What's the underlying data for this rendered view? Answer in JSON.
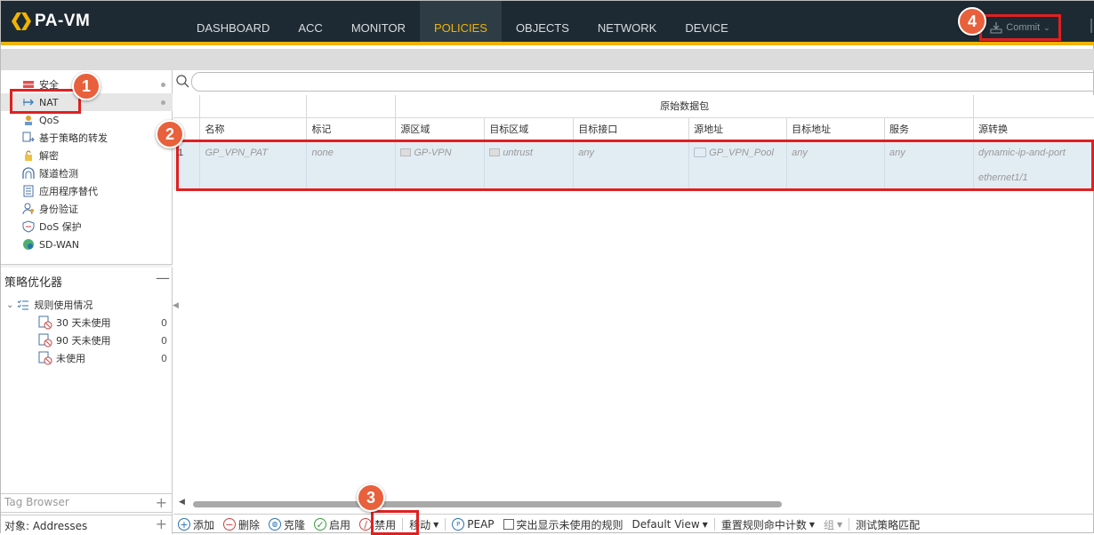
{
  "app": {
    "logo": "PA-VM"
  },
  "nav": {
    "tabs": [
      "DASHBOARD",
      "ACC",
      "MONITOR",
      "POLICIES",
      "OBJECTS",
      "NETWORK",
      "DEVICE"
    ],
    "active": "POLICIES"
  },
  "commit": {
    "label": "Commit"
  },
  "policy_nav": [
    {
      "label": "安全",
      "icon": "security-icon"
    },
    {
      "label": "NAT",
      "icon": "nat-icon"
    },
    {
      "label": "QoS",
      "icon": "qos-icon"
    },
    {
      "label": "基于策略的转发",
      "icon": "pbf-icon"
    },
    {
      "label": "解密",
      "icon": "lock-icon"
    },
    {
      "label": "隧道检测",
      "icon": "tunnel-icon"
    },
    {
      "label": "应用程序替代",
      "icon": "app-override-icon"
    },
    {
      "label": "身份验证",
      "icon": "auth-icon"
    },
    {
      "label": "DoS 保护",
      "icon": "dos-icon"
    },
    {
      "label": "SD-WAN",
      "icon": "sdwan-icon"
    }
  ],
  "optimizer": {
    "title": "策略优化器",
    "group": "规则使用情况",
    "items": [
      {
        "label": "30 天未使用",
        "count": "0"
      },
      {
        "label": "90 天未使用",
        "count": "0"
      },
      {
        "label": "未使用",
        "count": "0"
      }
    ]
  },
  "tag_browser": "Tag Browser",
  "objects": "对象: Addresses",
  "table": {
    "group_header": "原始数据包",
    "headers": [
      "名称",
      "标记",
      "源区域",
      "目标区域",
      "目标接口",
      "源地址",
      "目标地址",
      "服务",
      "源转换"
    ],
    "row": {
      "num": "1",
      "name": "GP_VPN_PAT",
      "tag": "none",
      "src_zone": "GP-VPN",
      "dst_zone": "untrust",
      "dst_if": "any",
      "src_addr": "GP_VPN_Pool",
      "dst_addr": "any",
      "service": "any",
      "src_trans_1": "dynamic-ip-and-port",
      "src_trans_2": "ethernet1/1"
    }
  },
  "toolbar": {
    "add": "添加",
    "delete": "删除",
    "clone": "克隆",
    "enable": "启用",
    "disable": "禁用",
    "move": "移动",
    "peap": "PEAP",
    "highlight": "突出显示未使用的规则",
    "view": "Default View",
    "reset": "重置规则命中计数",
    "group": "组",
    "test": "测试策略匹配"
  },
  "badges": [
    "1",
    "2",
    "3",
    "4"
  ],
  "colors": {
    "accent": "#f0b400",
    "annotation": "#e02020",
    "badge": "#e8603c",
    "topbar": "#1e2a33"
  }
}
